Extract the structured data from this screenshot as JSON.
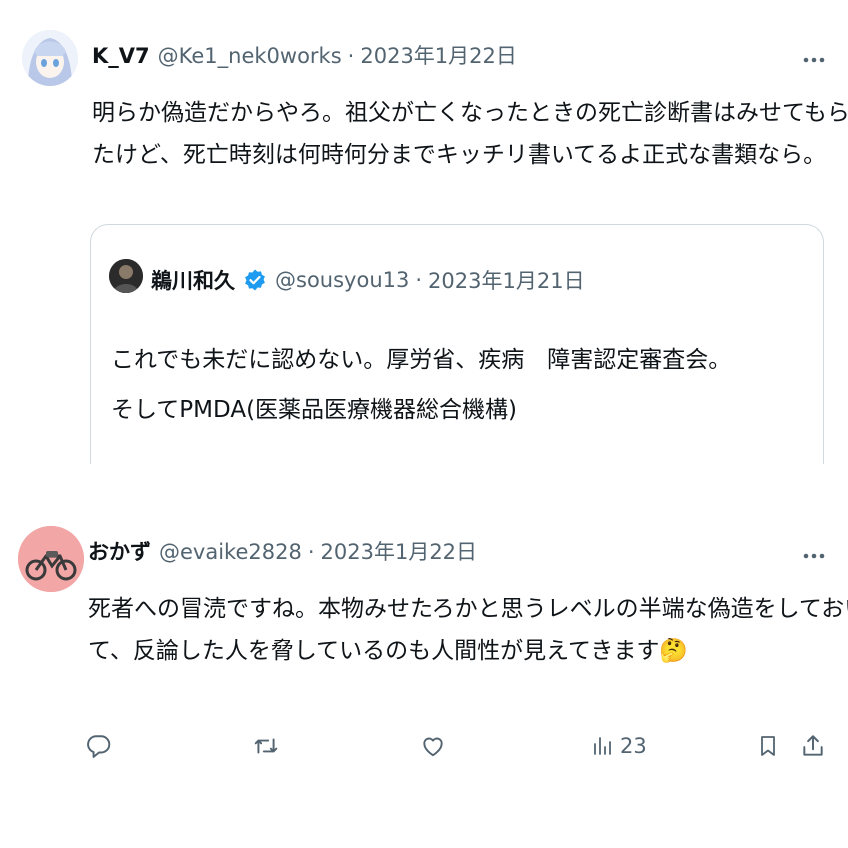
{
  "tweet1": {
    "display_name": "K_V7",
    "handle": "@Ke1_nek0works",
    "separator": "·",
    "date": "2023年1月22日",
    "text_lines": [
      "明らか偽造だからやろ。祖父が亡くなったときの死亡診断書はみせてもらっ",
      "たけど、死亡時刻は何時何分までキッチリ書いてるよ正式な書類なら。"
    ],
    "quote": {
      "display_name": "鵜川和久",
      "handle": "@sousyou13",
      "separator": "·",
      "date": "2023年1月21日",
      "text_lines": [
        "これでも未だに認めない。厚労省、疾病　障害認定審査会。",
        "そしてPMDA(医薬品医療機器総合機構)"
      ]
    }
  },
  "tweet2": {
    "display_name": "おかず",
    "handle": "@evaike2828",
    "separator": "·",
    "date": "2023年1月22日",
    "text_lines": [
      "死者への冒涜ですね。本物みせたろかと思うレベルの半端な偽造をしておい",
      "て、反論した人を脅しているのも人間性が見えてきます"
    ],
    "emoji": "🤔"
  },
  "actions": {
    "views_count": "23"
  },
  "colors": {
    "text": "#0f1419",
    "secondary": "#536471",
    "verified": "#1d9bf0",
    "border": "#cfd9de"
  }
}
